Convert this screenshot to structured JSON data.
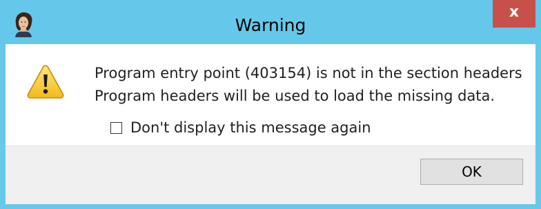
{
  "window": {
    "title": "Warning",
    "close_glyph": "x",
    "icon": "app-portrait-icon",
    "titlebar_color": "#65c8ea",
    "close_color": "#c7504b"
  },
  "message": {
    "icon": "warning-icon",
    "line1": "Program entry point (403154) is not in the section headers",
    "line2": "Program headers will be used to load the missing data."
  },
  "checkbox": {
    "label": "Don't display this message again",
    "checked": false
  },
  "buttons": {
    "ok_label": "OK"
  }
}
